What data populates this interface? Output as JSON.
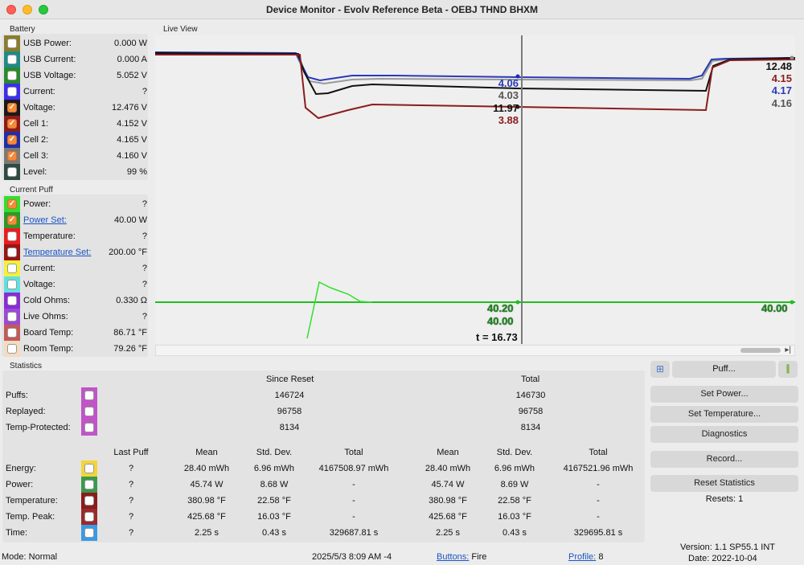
{
  "window": {
    "title": "Device Monitor - Evolv Reference Beta - OEBJ THND BHXM"
  },
  "battery": {
    "label": "Battery",
    "rows": [
      {
        "label": "USB Power:",
        "value": "0.000 W",
        "color": "#8a7d2a",
        "checked": false
      },
      {
        "label": "USB Current:",
        "value": "0.000 A",
        "color": "#1f8a8a",
        "checked": false
      },
      {
        "label": "USB Voltage:",
        "value": "5.052 V",
        "color": "#2a8a2a",
        "checked": false
      },
      {
        "label": "Current:",
        "value": "?",
        "color": "#3d2df0",
        "checked": false
      },
      {
        "label": "Voltage:",
        "value": "12.476 V",
        "color": "#1a1a1a",
        "checked": true
      },
      {
        "label": "Cell 1:",
        "value": "4.152 V",
        "color": "#8b1c1c",
        "checked": true
      },
      {
        "label": "Cell 2:",
        "value": "4.165 V",
        "color": "#1f2fa8",
        "checked": true
      },
      {
        "label": "Cell 3:",
        "value": "4.160 V",
        "color": "#7a7a7a",
        "checked": true
      },
      {
        "label": "Level:",
        "value": "99 %",
        "color": "#2e4a44",
        "checked": false
      }
    ]
  },
  "current_puff": {
    "label": "Current Puff",
    "rows": [
      {
        "label": "Power:",
        "value": "?",
        "color": "#2fe02f",
        "checked": true,
        "link": false
      },
      {
        "label": "Power Set:",
        "value": "40.00 W",
        "color": "#2a9a2a",
        "checked": true,
        "link": true
      },
      {
        "label": "Temperature:",
        "value": "?",
        "color": "#ee1c1c",
        "checked": false,
        "link": false
      },
      {
        "label": "Temperature Set:",
        "value": "200.00 °F",
        "color": "#9a1414",
        "checked": false,
        "link": true
      },
      {
        "label": "Current:",
        "value": "?",
        "color": "#f5f03a",
        "checked": false,
        "link": false
      },
      {
        "label": "Voltage:",
        "value": "?",
        "color": "#5fe0e0",
        "checked": false,
        "link": false
      },
      {
        "label": "Cold Ohms:",
        "value": "0.330 Ω",
        "color": "#8a2bd6",
        "checked": false,
        "link": false
      },
      {
        "label": "Live Ohms:",
        "value": "?",
        "color": "#9a4ad6",
        "checked": false,
        "link": false
      },
      {
        "label": "Board Temp:",
        "value": "86.71 °F",
        "color": "#c25a5a",
        "checked": false,
        "link": false
      },
      {
        "label": "Room Temp:",
        "value": "79.26 °F",
        "color": "#f5dcc0",
        "checked": false,
        "link": false
      }
    ]
  },
  "live_view": {
    "label": "Live View",
    "cursor_labels": [
      {
        "text": "4.06",
        "color": "#2a3ab8"
      },
      {
        "text": "4.03",
        "color": "#555555"
      },
      {
        "text": "11.97",
        "color": "#111111"
      },
      {
        "text": "3.88",
        "color": "#8b1c1c"
      }
    ],
    "right_labels": [
      {
        "text": "12.48",
        "color": "#111111"
      },
      {
        "text": "4.15",
        "color": "#8b1c1c"
      },
      {
        "text": "4.17",
        "color": "#2a3ab8"
      },
      {
        "text": "4.16",
        "color": "#555555"
      }
    ],
    "cursor_green_labels": [
      "40.20",
      "40.00"
    ],
    "right_green_label": "40.00",
    "time_label": "t = 16.73",
    "colors": {
      "voltage": "#111111",
      "cell1": "#8b1c1c",
      "cell2": "#2a3ab8",
      "cell3": "#9a9a9a",
      "power_set": "#1fbf1f",
      "power": "#2fe02f"
    }
  },
  "statistics": {
    "label": "Statistics",
    "since_reset": "Since Reset",
    "total": "Total",
    "top_rows": [
      {
        "label": "Puffs:",
        "since": "146724",
        "total": "146730",
        "color": "#c054c8"
      },
      {
        "label": "Replayed:",
        "since": "96758",
        "total": "96758",
        "color": "#c054c8"
      },
      {
        "label": "Temp-Protected:",
        "since": "8134",
        "total": "8134",
        "color": "#c054c8"
      }
    ],
    "columns": [
      "Last Puff",
      "Mean",
      "Std. Dev.",
      "Total",
      "Mean",
      "Std. Dev.",
      "Total"
    ],
    "rows": [
      {
        "label": "Energy:",
        "color": "#f5d43a",
        "cells": [
          "?",
          "28.40 mWh",
          "6.96 mWh",
          "4167508.97 mWh",
          "28.40 mWh",
          "6.96 mWh",
          "4167521.96 mWh"
        ]
      },
      {
        "label": "Power:",
        "color": "#3a9a4a",
        "cells": [
          "?",
          "45.74 W",
          "8.68 W",
          "-",
          "45.74 W",
          "8.69 W",
          "-"
        ]
      },
      {
        "label": "Temperature:",
        "color": "#8b1c1c",
        "cells": [
          "?",
          "380.98 °F",
          "22.58 °F",
          "-",
          "380.98 °F",
          "22.58 °F",
          "-"
        ]
      },
      {
        "label": "Temp. Peak:",
        "color": "#9a2a2a",
        "cells": [
          "?",
          "425.68 °F",
          "16.03 °F",
          "-",
          "425.68 °F",
          "16.03 °F",
          "-"
        ]
      },
      {
        "label": "Time:",
        "color": "#3a9ae6",
        "cells": [
          "?",
          "2.25 s",
          "0.43 s",
          "329687.81 s",
          "2.25 s",
          "0.43 s",
          "329695.81 s"
        ]
      }
    ]
  },
  "buttons": {
    "puff": "Puff...",
    "set_power": "Set Power...",
    "set_temperature": "Set Temperature...",
    "diagnostics": "Diagnostics",
    "record": "Record...",
    "reset_statistics": "Reset Statistics",
    "resets": "Resets: 1"
  },
  "footer": {
    "mode": "Mode: Normal",
    "datetime": "2025/5/3 8:09 AM -4",
    "buttons_link": "Buttons:",
    "buttons_value": "Fire",
    "profile_link": "Profile:",
    "profile_value": "8",
    "version": "Version: 1.1 SP55.1 INT",
    "date": "Date: 2022-10-04"
  }
}
